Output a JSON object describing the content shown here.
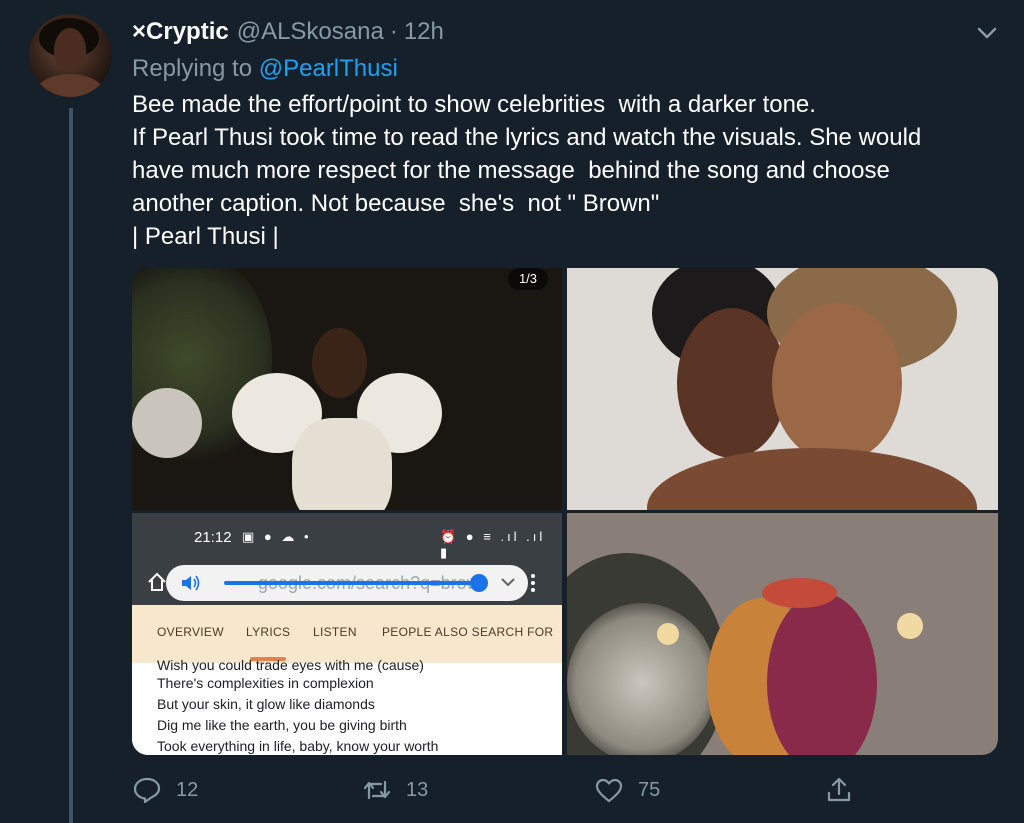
{
  "tweet": {
    "display_name": "×Cryptic",
    "handle": "@ALSkosana",
    "separator": "·",
    "time": "12h",
    "reply_prefix": "Replying to ",
    "reply_to": "@PearlThusi",
    "text_lines": [
      "Bee made the effort/point to show celebrities  with a darker tone.",
      "If Pearl Thusi took time to read the lyrics and watch the visuals. She would",
      "have much more respect for the message  behind the song and choose",
      "another caption. Not because  she's  not \" Brown\"",
      "| Pearl Thusi |"
    ]
  },
  "media": {
    "counter": "1/3",
    "phone": {
      "clock": "21:12",
      "status_left_icons": "▣ ● ☁ •",
      "status_right_icons": "⏰ ● ≡ .ıl .ıl ▮",
      "url_ghost": "google.com/search?q=brow",
      "tabs": [
        "OVERVIEW",
        "LYRICS",
        "LISTEN",
        "PEOPLE ALSO SEARCH FOR"
      ],
      "lyrics": [
        "Wish you could trade eyes with me (cause)",
        "There's complexities in complexion",
        "But your skin, it glow like diamonds",
        "Dig me like the earth, you be giving birth",
        "Took everything in life, baby, know your worth"
      ]
    }
  },
  "actions": {
    "replies": "12",
    "retweets": "13",
    "likes": "75"
  },
  "colors": {
    "background": "#15202b",
    "muted": "#8899a6",
    "link": "#1da1f2",
    "thread_line": "#3d5466"
  },
  "icons": [
    "chevron-down-icon",
    "reply-icon",
    "retweet-icon",
    "like-icon",
    "share-icon",
    "home-icon",
    "speaker-icon",
    "kebab-icon"
  ]
}
